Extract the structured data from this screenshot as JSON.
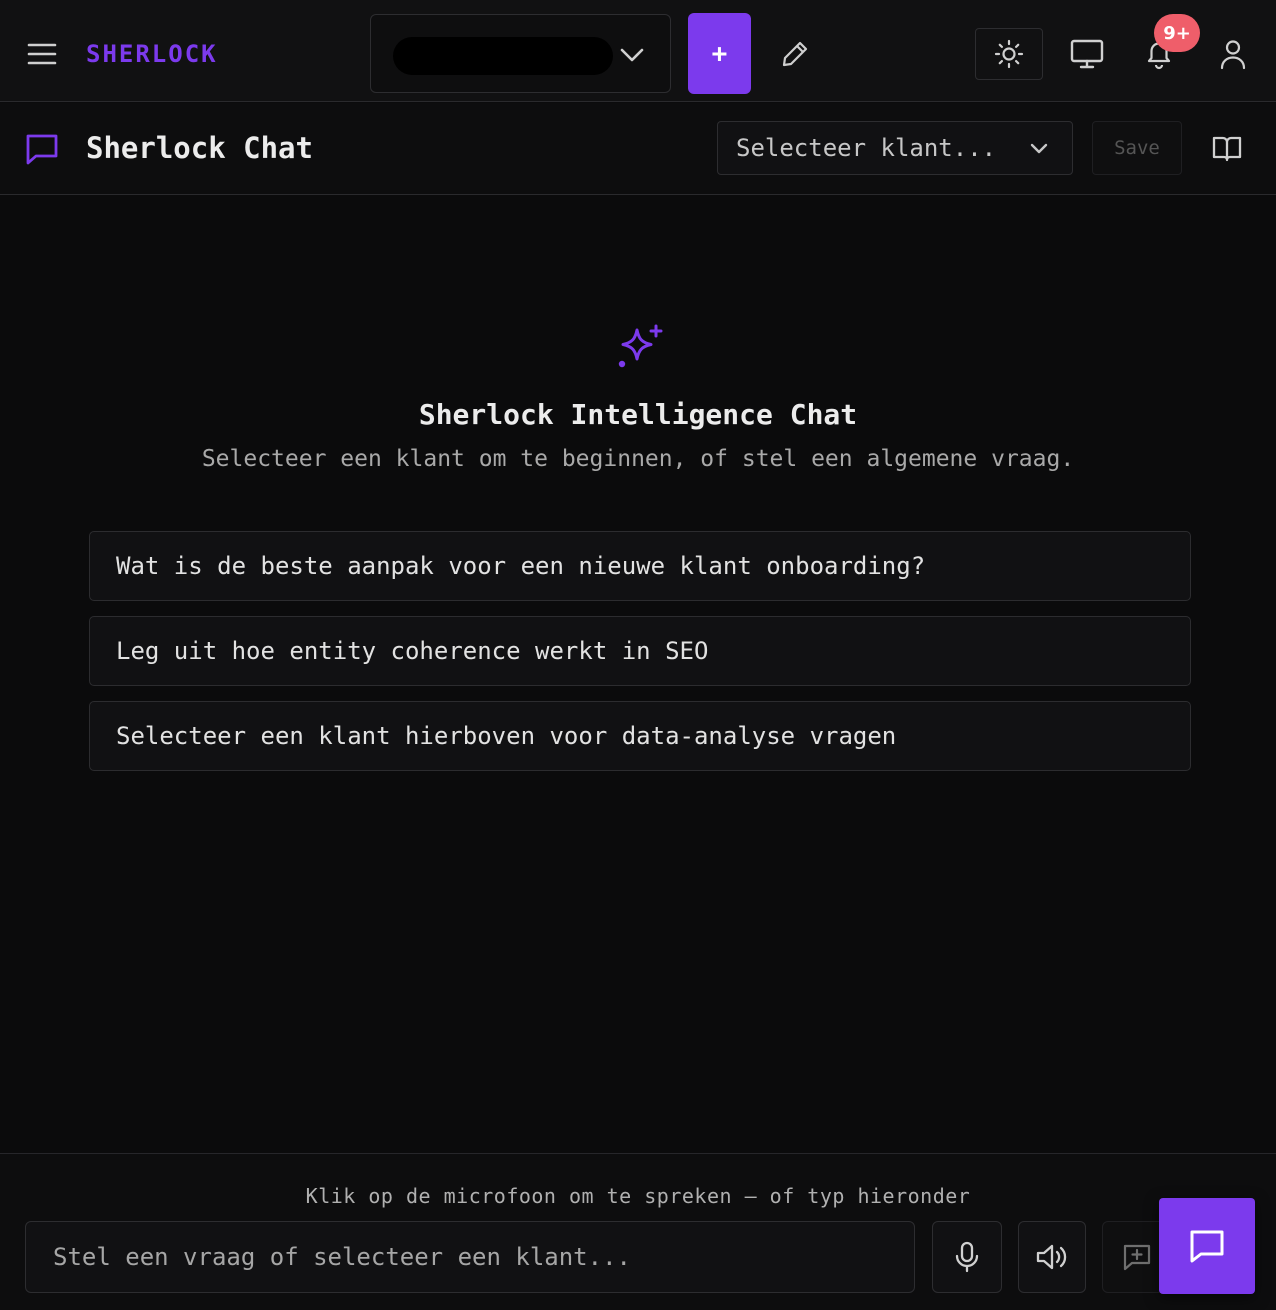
{
  "colors": {
    "accent": "#7c3aed",
    "badge": "#ef5e6a",
    "background": "#0b0b0c"
  },
  "header": {
    "brand": "SHERLOCK",
    "client_selector_value": "",
    "add_label": "+",
    "notifications_badge": "9+",
    "icons": [
      "menu-icon",
      "chevron-down-icon",
      "pencil-icon",
      "sun-icon",
      "monitor-icon",
      "bell-icon",
      "user-icon"
    ]
  },
  "subheader": {
    "title": "Sherlock Chat",
    "client_select_placeholder": "Selecteer klant...",
    "save_label": "Save",
    "icons": [
      "chat-bubble-icon",
      "chevron-down-icon",
      "book-open-icon"
    ]
  },
  "main": {
    "hero_title": "Sherlock Intelligence Chat",
    "hero_subtitle": "Selecteer een klant om te beginnen, of stel een algemene vraag.",
    "suggestions": [
      "Wat is de beste aanpak voor een nieuwe klant onboarding?",
      "Leg uit hoe entity coherence werkt in SEO",
      "Selecteer een klant hierboven voor data-analyse vragen"
    ]
  },
  "footer": {
    "hint": "Klik op de microfoon om te spreken — of typ hieronder",
    "input_placeholder": "Stel een vraag of selecteer een klant...",
    "icons": [
      "microphone-icon",
      "speaker-icon",
      "message-plus-icon",
      "chat-icon"
    ]
  }
}
